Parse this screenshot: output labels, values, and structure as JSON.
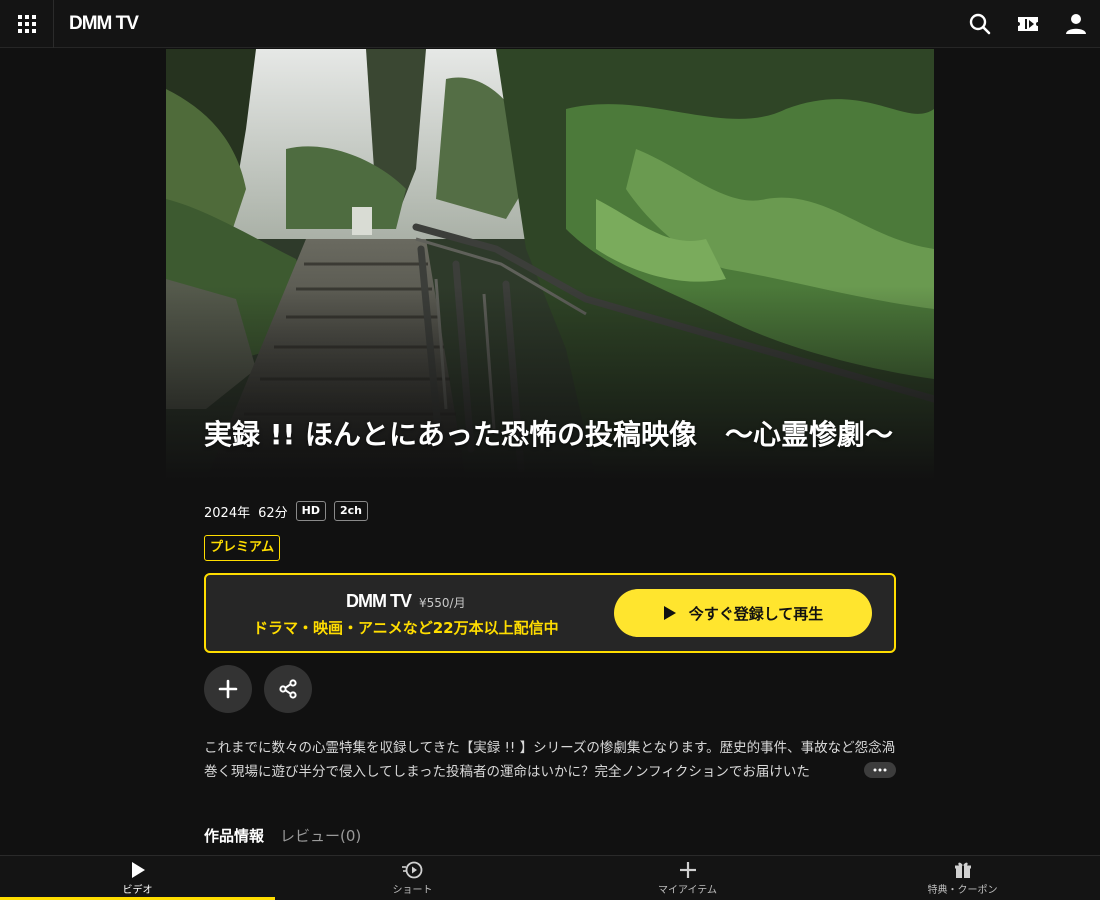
{
  "header": {
    "logo": "DMM TV",
    "icons": [
      "apps-grid-icon",
      "search-icon",
      "ticket-icon",
      "user-icon"
    ]
  },
  "title": "実録 !! ほんとにあった恐怖の投稿映像　～心霊惨劇～",
  "meta": {
    "year": "2024年",
    "duration": "62分",
    "badges": [
      "HD",
      "2ch"
    ]
  },
  "premium_label": "プレミアム",
  "promo": {
    "logo": "DMM TV",
    "price": "¥550/月",
    "tagline": "ドラマ・映画・アニメなど22万本以上配信中",
    "play_label": "今すぐ登録して再生",
    "accent": "#ffdd00"
  },
  "actions": [
    "plus-icon",
    "share-icon"
  ],
  "description": "これまでに数々の心霊特集を収録してきた【実録 !! 】シリーズの惨劇集となります。歴史的事件、事故など怨念渦巻く現場に遊び半分で侵入してしまった投稿者の運命はいかに？完全ノンフィクションでお届けいた",
  "tabs": {
    "info": "作品情報",
    "review": "レビュー(0)"
  },
  "bottom_nav": [
    {
      "label": "ビデオ",
      "icon": "play-icon",
      "active": true
    },
    {
      "label": "ショート",
      "icon": "short-play-icon",
      "active": false
    },
    {
      "label": "マイアイテム",
      "icon": "plus-icon",
      "active": false
    },
    {
      "label": "特典・クーポン",
      "icon": "gift-icon",
      "active": false
    }
  ]
}
